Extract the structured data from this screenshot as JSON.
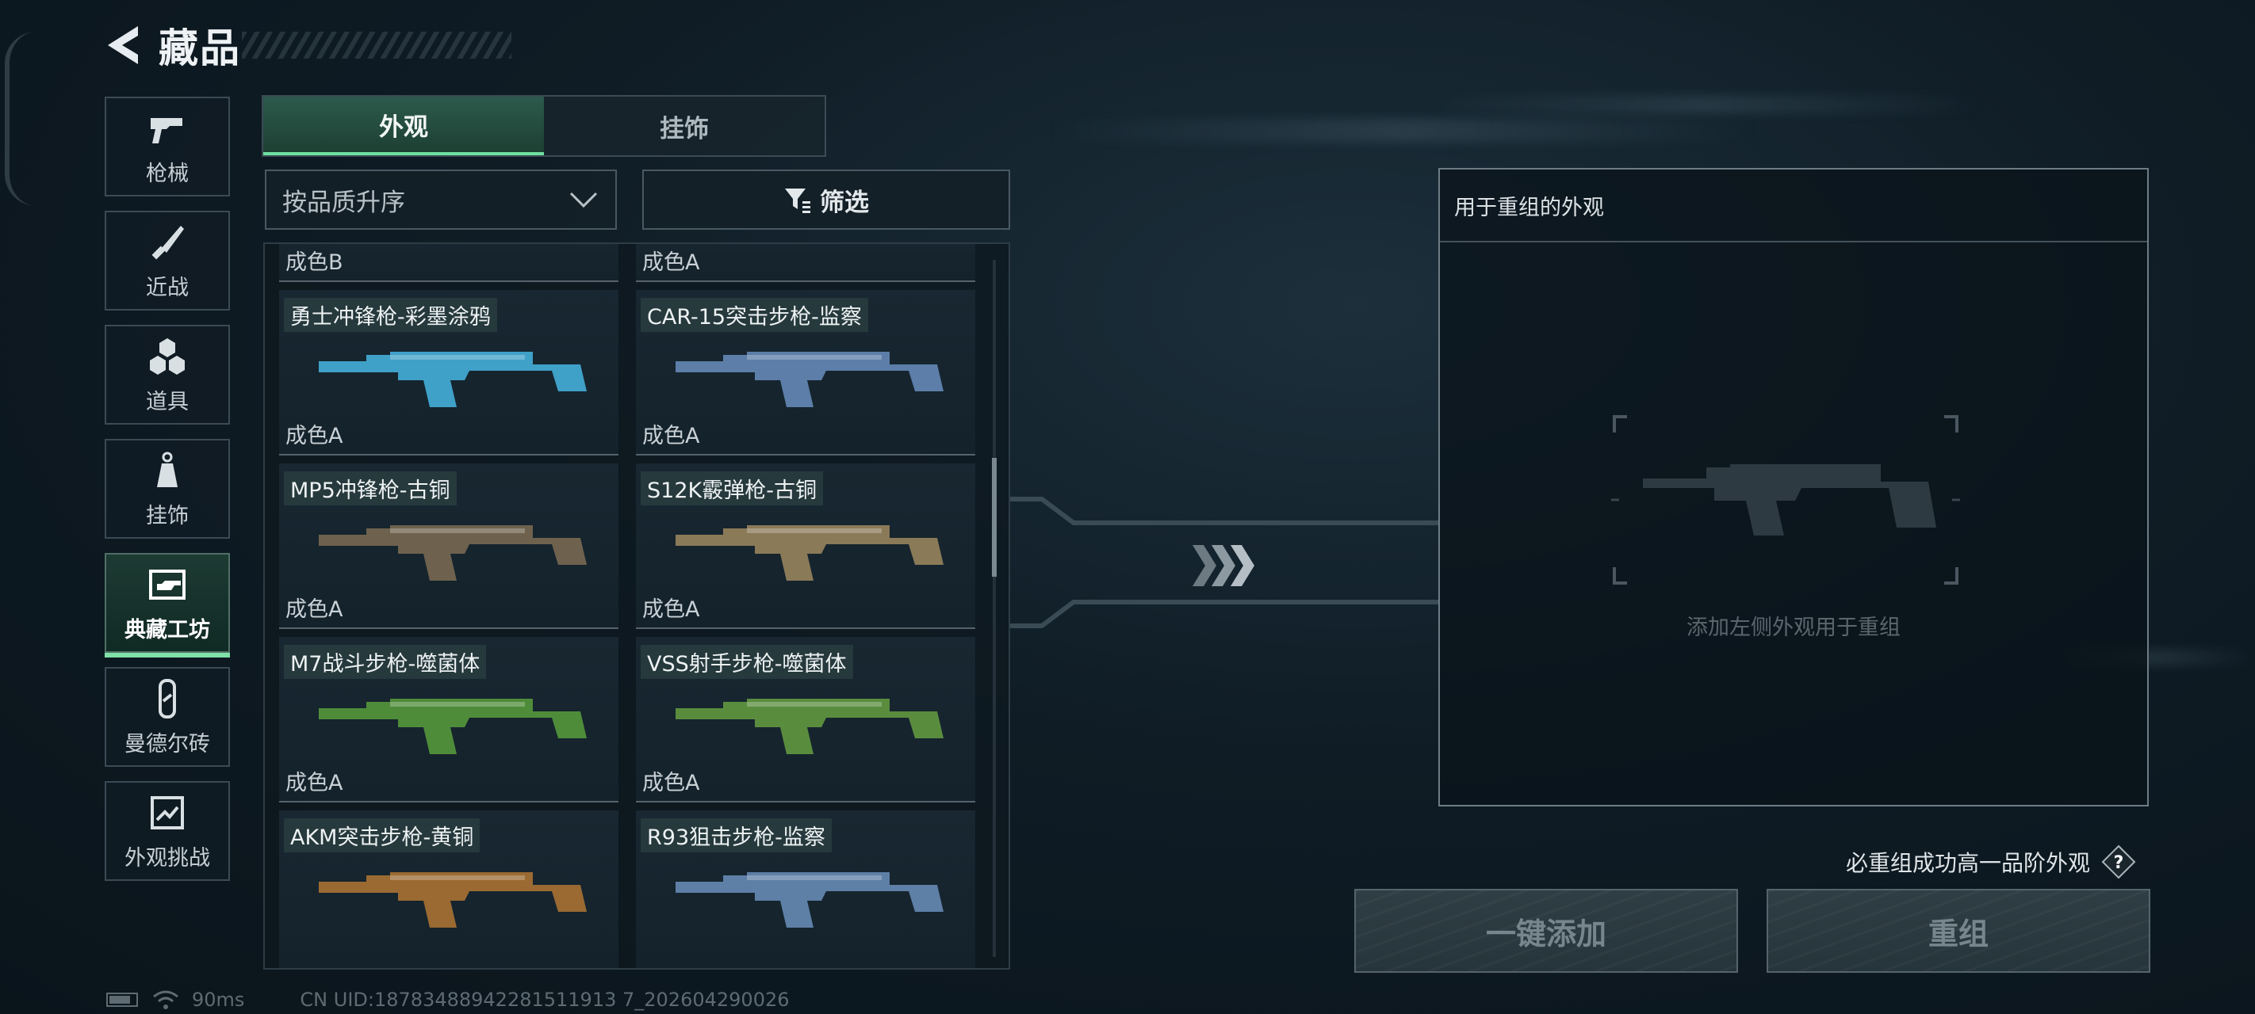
{
  "header": {
    "title": "藏品"
  },
  "sidebar": {
    "items": [
      {
        "label": "枪械",
        "icon": "pistol-icon",
        "active": false
      },
      {
        "label": "近战",
        "icon": "knife-icon",
        "active": false
      },
      {
        "label": "道具",
        "icon": "grenade-cluster-icon",
        "active": false
      },
      {
        "label": "挂饰",
        "icon": "charm-icon",
        "active": false
      },
      {
        "label": "典藏工坊",
        "icon": "workshop-icon",
        "active": true
      },
      {
        "label": "曼德尔砖",
        "icon": "brick-icon",
        "active": false
      },
      {
        "label": "外观挑战",
        "icon": "challenge-icon",
        "active": false
      }
    ]
  },
  "tabs": [
    {
      "label": "外观",
      "active": true
    },
    {
      "label": "挂饰",
      "active": false
    }
  ],
  "sort": {
    "label": "按品质升序"
  },
  "filter": {
    "label": "筛选"
  },
  "grid": {
    "cards": [
      {
        "name": "",
        "grade": "成色B",
        "color": "#8f9aa0"
      },
      {
        "name": "",
        "grade": "成色A",
        "color": "#8f9aa0"
      },
      {
        "name": "勇士冲锋枪-彩墨涂鸦",
        "grade": "成色A",
        "color": "#3fa0c8"
      },
      {
        "name": "CAR-15突击步枪-监察",
        "grade": "成色A",
        "color": "#5c7ea8"
      },
      {
        "name": "MP5冲锋枪-古铜",
        "grade": "成色A",
        "color": "#6e624e"
      },
      {
        "name": "S12K霰弹枪-古铜",
        "grade": "成色A",
        "color": "#8a7a58"
      },
      {
        "name": "M7战斗步枪-噬菌体",
        "grade": "成色A",
        "color": "#4f8c3a"
      },
      {
        "name": "VSS射手步枪-噬菌体",
        "grade": "成色A",
        "color": "#5a8c3e"
      },
      {
        "name": "AKM突击步枪-黄铜",
        "grade": "",
        "color": "#9a6a32"
      },
      {
        "name": "R93狙击步枪-监察",
        "grade": "",
        "color": "#5e7fa6"
      }
    ]
  },
  "recombine": {
    "title": "用于重组的外观",
    "hint": "添加左侧外观用于重组"
  },
  "guarantee": {
    "text": "必重组成功高一品阶外观"
  },
  "buttons": {
    "add": "一键添加",
    "recombine": "重组"
  },
  "status": {
    "ping": "90ms",
    "uid": "CN UID:18783488942281511913 7_202604290026"
  }
}
